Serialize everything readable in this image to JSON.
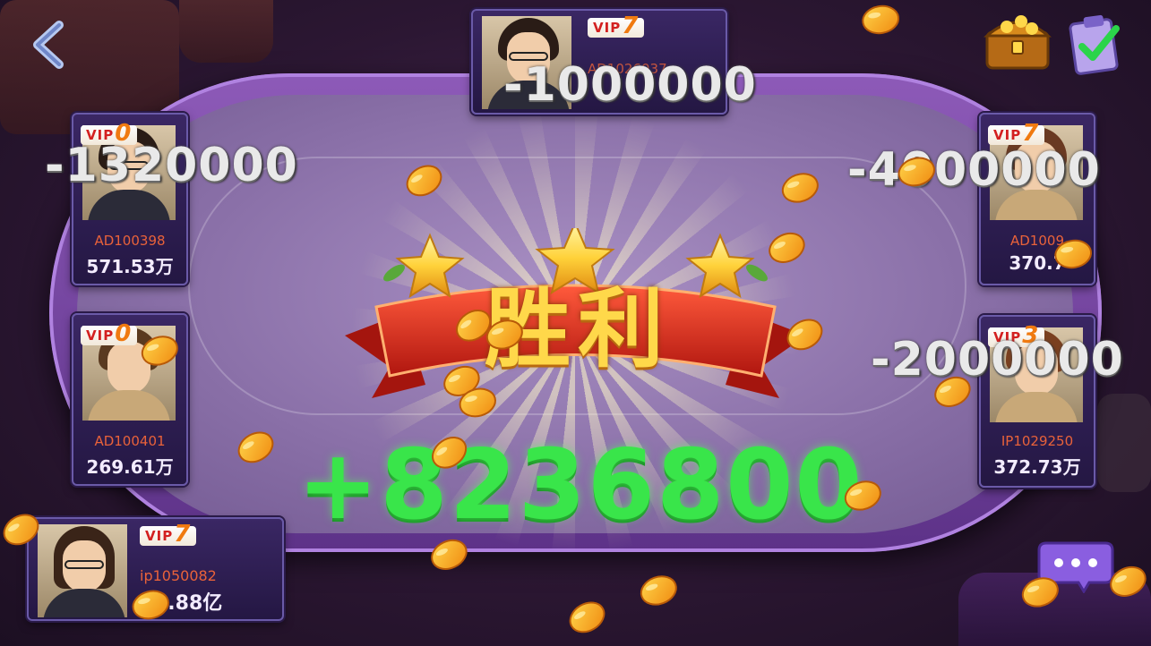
{
  "victory": {
    "text": "胜利"
  },
  "winnings": "+8236800",
  "players": [
    {
      "id": "top",
      "vip_label": "VIP",
      "vip_level": "7",
      "player_id": "AD1026037",
      "coins": "",
      "score_change": "-1000000"
    },
    {
      "id": "left-top",
      "vip_label": "VIP",
      "vip_level": "0",
      "player_id": "AD100398",
      "coins": "571.53万",
      "score_change": "-1320000"
    },
    {
      "id": "left-bottom",
      "vip_label": "VIP",
      "vip_level": "0",
      "player_id": "AD100401",
      "coins": "269.61万",
      "score_change": ""
    },
    {
      "id": "right-top",
      "vip_label": "VIP",
      "vip_level": "7",
      "player_id": "AD1009",
      "coins": "370.7",
      "score_change": "-4000000"
    },
    {
      "id": "right-bottom",
      "vip_label": "VIP",
      "vip_level": "3",
      "player_id": "IP1029250",
      "coins": "372.73万",
      "score_change": "-2000000"
    },
    {
      "id": "self",
      "vip_label": "VIP",
      "vip_level": "7",
      "player_id": "ip1050082",
      "coins": "3.88亿",
      "score_change": ""
    }
  ],
  "icons": {
    "back": "back-arrow-icon",
    "treasure": "treasure-chest-icon",
    "tasks": "clipboard-check-icon",
    "chat": "chat-bubble-icon",
    "coin": "mango-coin-icon"
  },
  "colors": {
    "win": "#39e54a",
    "loss": "#e9e9e9",
    "vip": "#d32020",
    "ribbon": "#d8261c",
    "title_gold": "#ffd84a"
  }
}
